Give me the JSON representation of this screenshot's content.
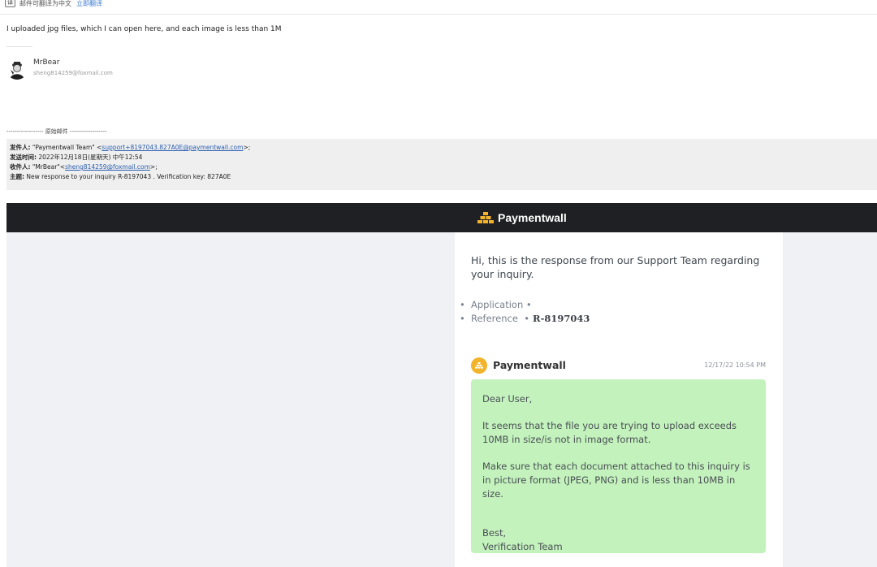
{
  "translate_bar": {
    "icon": "translate-icon",
    "icon_glyph": "译",
    "text": "邮件可翻译为中文",
    "link": "立即翻译"
  },
  "reply": {
    "body": "I uploaded jpg files, which I can open here, and each image is less than 1M"
  },
  "signature": {
    "name": "MrBear",
    "email": "sheng814259@foxmail.com"
  },
  "original": {
    "separator": "------------------ 原始邮件 ------------------",
    "from_label": "发件人:",
    "from_name": "\"Paymentwall Team\" <",
    "from_email": "support+8197043.827A0E@paymentwall.com",
    "from_tail": ">;",
    "date_label": "发送时间:",
    "date": "2022年12月18日(星期天) 中午12:54",
    "to_label": "收件人:",
    "to_name": "\"MrBear\"<",
    "to_email": "sheng814259@foxmail.com",
    "to_tail": ">;",
    "subject_label": "主题:",
    "subject": "New response to your inquiry R-8197043 . Verification key: 827A0E"
  },
  "paymentwall": {
    "brand": "Paymentwall",
    "logo_icon": "gold-bars-icon",
    "brand_color": "#f3b32a",
    "greeting": "Hi, this is the response from our Support Team regarding your inquiry.",
    "meta": [
      {
        "label": "Application",
        "value": ""
      },
      {
        "label": "Reference",
        "value": "R-8197043"
      }
    ],
    "message": {
      "sender": "Paymentwall",
      "time": "12/17/22 10:54 PM",
      "bubble_color": "#c3f2bd",
      "salutation": "Dear User,",
      "para1": "It seems that the file you are trying to upload exceeds 10MB in size/is not in image format.",
      "para2": "Make sure that each document attached to this inquiry is in picture format (JPEG, PNG) and is less than 10MB in size.",
      "closing": "Best,",
      "team": "Verification Team"
    }
  }
}
